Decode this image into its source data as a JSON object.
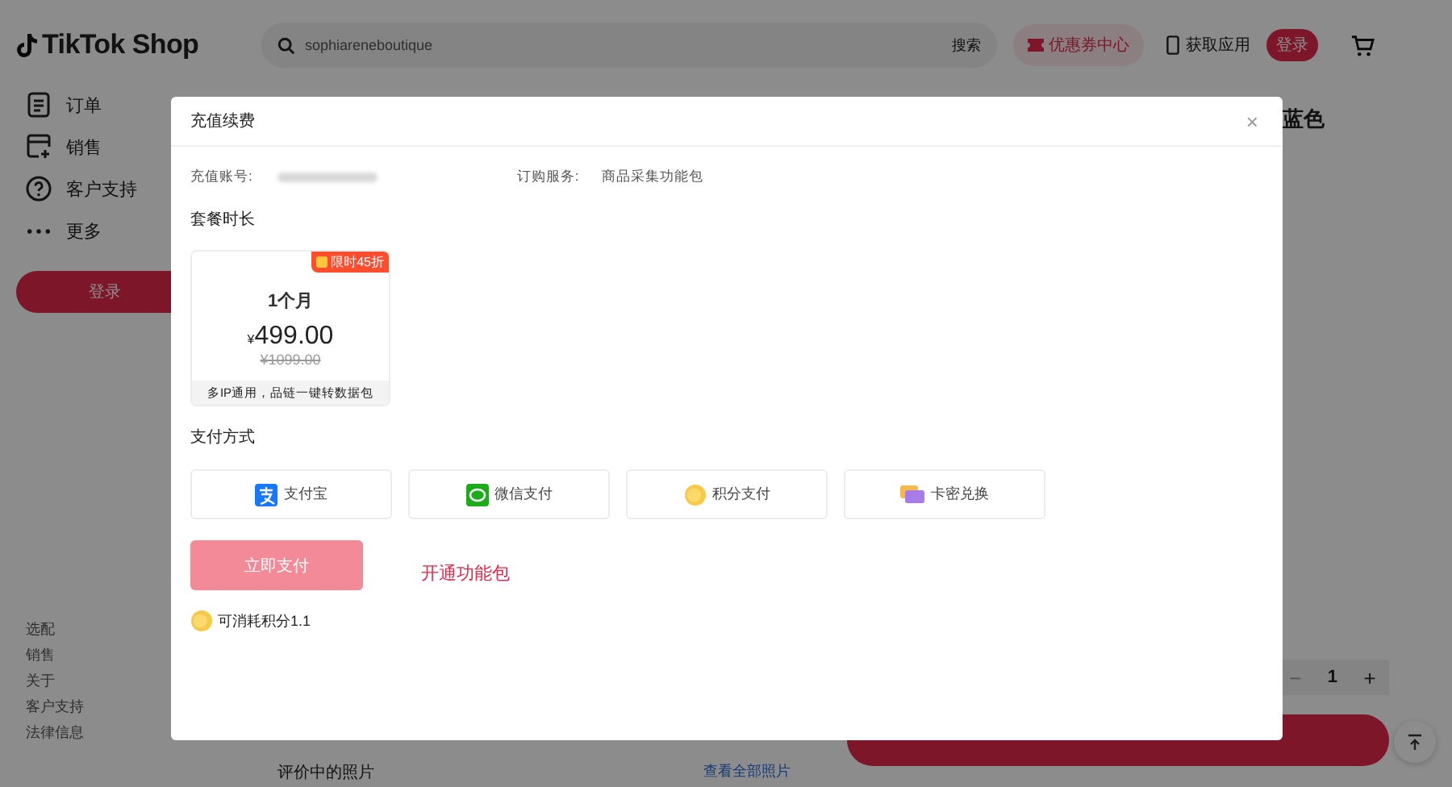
{
  "header": {
    "logo": "TikTok Shop",
    "search": {
      "value": "sophiareneboutique",
      "button": "搜索"
    },
    "coupon": "优惠券中心",
    "get_app": "获取应用",
    "login": "登录"
  },
  "sidebar": {
    "items": [
      {
        "label": "订单"
      },
      {
        "label": "销售"
      },
      {
        "label": "客户支持"
      },
      {
        "label": "更多"
      }
    ],
    "login": "登录",
    "footer_links": [
      "选配",
      "销售",
      "关于",
      "客户支持",
      "法律信息"
    ]
  },
  "product": {
    "title": "蓝色",
    "quantity": {
      "minus": "−",
      "value": "1",
      "plus": "+"
    },
    "reviews_title": "评价中的照片",
    "view_all": "查看全部照片"
  },
  "dialog": {
    "title": "充值续费",
    "close": "×",
    "account": {
      "label": "充值账号:"
    },
    "service": {
      "label": "订购服务:",
      "value": "商品采集功能包"
    },
    "plan_heading": "套餐时长",
    "plans": [
      {
        "badge": "限时45折",
        "name": "1个月",
        "currency": "¥",
        "price": "499.00",
        "original_price": "¥1099.00",
        "note": "多IP通用，品链一键转数据包"
      }
    ],
    "payment_heading": "支付方式",
    "payment_methods": [
      {
        "label": "支付宝",
        "kind": "alipay"
      },
      {
        "label": "微信支付",
        "kind": "wechat"
      },
      {
        "label": "积分支付",
        "kind": "points"
      },
      {
        "label": "卡密兑换",
        "kind": "card"
      }
    ],
    "pay_button": {
      "label": "立即支付",
      "disabled": true
    },
    "activate_link": "开通功能包",
    "points": "可消耗积分1.1"
  }
}
